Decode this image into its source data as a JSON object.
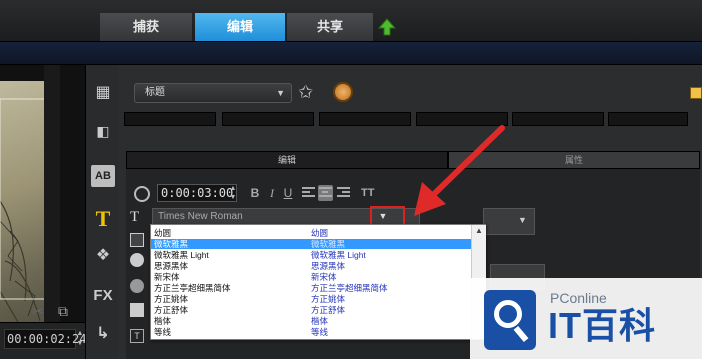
{
  "top_tabs": {
    "capture": "捕获",
    "edit": "编辑",
    "share": "共享"
  },
  "preview": {
    "timecode": "00:00:02:24"
  },
  "main": {
    "preset_dropdown": "标题",
    "subtabs": {
      "edit": "编辑",
      "attributes": "属性"
    },
    "duration": "0:00:03:00",
    "format": {
      "bold": "B",
      "italic": "I",
      "underline": "U",
      "text_size": "TT"
    },
    "font_select_value": "Times New Roman",
    "font_list": [
      {
        "name": "幼圆",
        "preview": "幼圆"
      },
      {
        "name": "微软雅黑",
        "preview": "微软雅黑",
        "selected": true
      },
      {
        "name": "微软雅黑 Light",
        "preview": "微软雅黑 Light"
      },
      {
        "name": "思源黑体",
        "preview": "思源黑体"
      },
      {
        "name": "新宋体",
        "preview": "新宋体"
      },
      {
        "name": "方正兰亭超细黑简体",
        "preview": "方正兰亭超细黑简体"
      },
      {
        "name": "方正姚体",
        "preview": "方正姚体"
      },
      {
        "name": "方正舒体",
        "preview": "方正舒体"
      },
      {
        "name": "楷体",
        "preview": "楷体"
      },
      {
        "name": "等线",
        "preview": "等线"
      }
    ]
  },
  "toolbar": {
    "title_tool": "T",
    "ab_tool": "AB",
    "fx_tool": "FX"
  },
  "watermark": {
    "small": "PConline",
    "big": "IT百科"
  },
  "colors": {
    "accent_tab": "#2aa0e8",
    "highlight": "#e02020",
    "selection": "#3399ff"
  },
  "icons": [
    "upload-icon",
    "star-plus-icon",
    "clock-icon",
    "scissors-icon",
    "copy-icon",
    "search-icon"
  ]
}
